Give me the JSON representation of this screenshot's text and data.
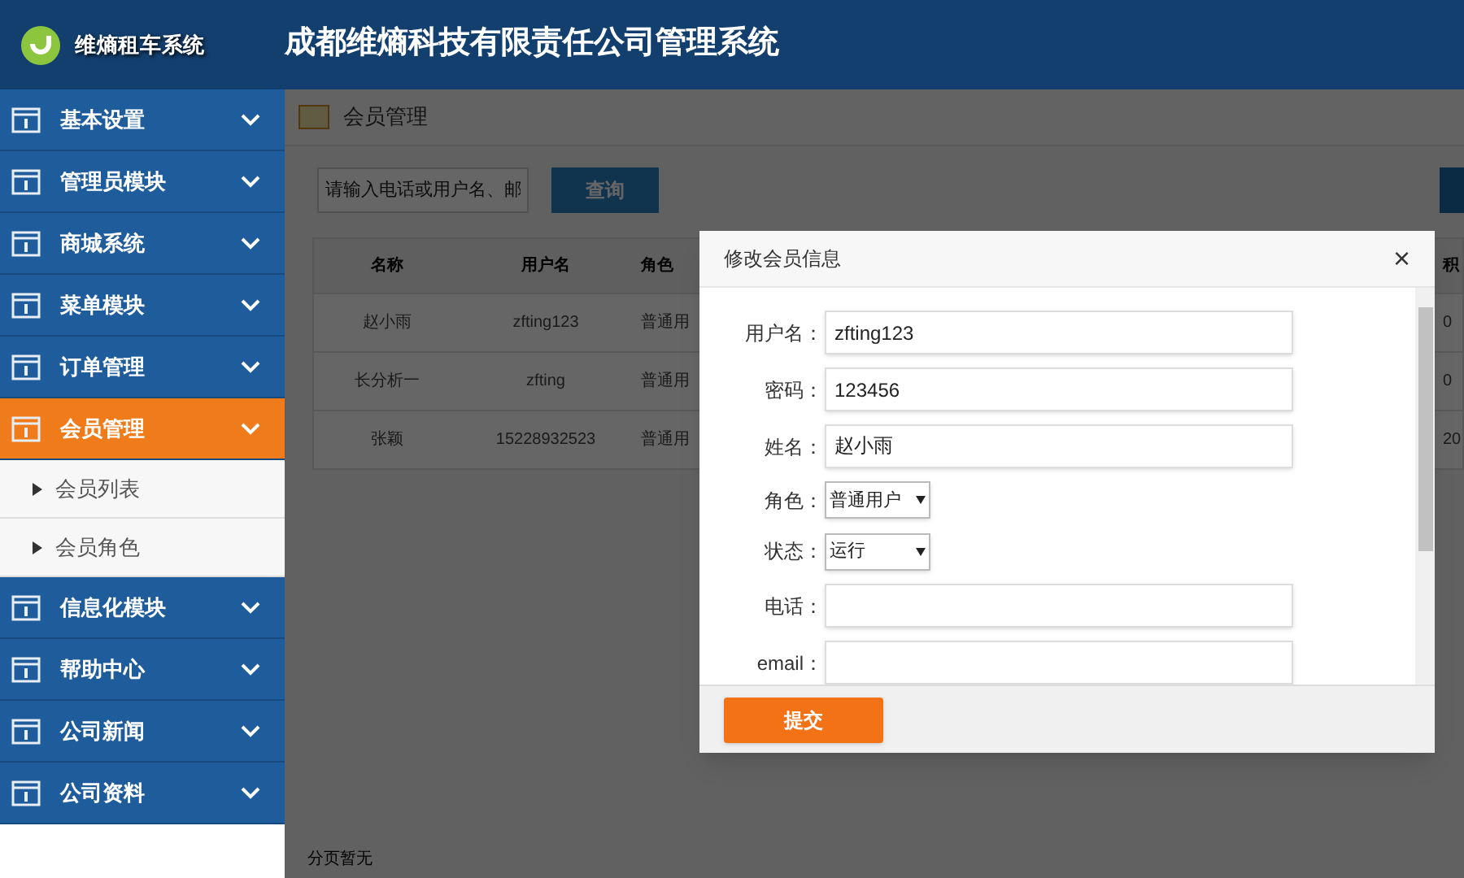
{
  "header": {
    "logo_text": "维熵租车系统",
    "title": "成都维熵科技有限责任公司管理系统"
  },
  "sidebar": {
    "items": [
      {
        "label": "基本设置",
        "selected": false
      },
      {
        "label": "管理员模块",
        "selected": false
      },
      {
        "label": "商城系统",
        "selected": false
      },
      {
        "label": "菜单模块",
        "selected": false
      },
      {
        "label": "订单管理",
        "selected": false
      },
      {
        "label": "会员管理",
        "selected": true,
        "children": [
          {
            "label": "会员列表"
          },
          {
            "label": "会员角色"
          }
        ]
      },
      {
        "label": "信息化模块",
        "selected": false
      },
      {
        "label": "帮助中心",
        "selected": false
      },
      {
        "label": "公司新闻",
        "selected": false
      },
      {
        "label": "公司资料",
        "selected": false
      }
    ]
  },
  "page": {
    "title": "会员管理",
    "search": {
      "placeholder": "请输入电话或用户名、邮"
    },
    "query_button": "查询",
    "table": {
      "columns": [
        "名称",
        "用户名",
        "角色",
        "积"
      ],
      "rows": [
        [
          "赵小雨",
          "zfting123",
          "普通用",
          "0"
        ],
        [
          "长分析一",
          "zfting",
          "普通用",
          "0"
        ],
        [
          "张颖",
          "15228932523",
          "普通用",
          "20"
        ]
      ]
    },
    "footer": "分页暂无"
  },
  "modal": {
    "title": "修改会员信息",
    "close": "×",
    "fields": [
      {
        "kind": "text",
        "label": "用户名：",
        "value": "zfting123"
      },
      {
        "kind": "text",
        "label": "密码：",
        "value": "123456"
      },
      {
        "kind": "text",
        "label": "姓名：",
        "value": "赵小雨"
      },
      {
        "kind": "select",
        "label": "角色：",
        "value": "普通用户"
      },
      {
        "kind": "select",
        "label": "状态：",
        "value": "运行"
      },
      {
        "kind": "text",
        "label": "电话："
      },
      {
        "kind": "text",
        "label": "email："
      }
    ],
    "submit": "提交"
  }
}
